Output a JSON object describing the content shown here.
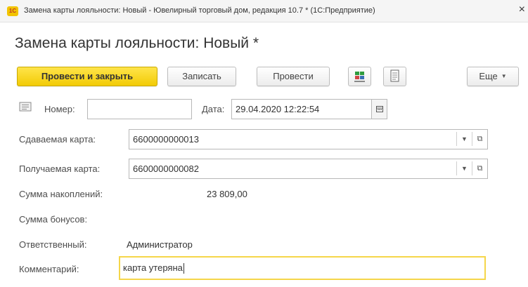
{
  "window": {
    "title": "Замена карты лояльности: Новый - Ювелирный торговый дом, редакция 10.7 * (1С:Предприятие)",
    "close_glyph": "×",
    "app_icon_text": "1С"
  },
  "form": {
    "title": "Замена карты лояльности: Новый *"
  },
  "toolbar": {
    "post_close_label": "Провести и закрыть",
    "save_label": "Записать",
    "post_label": "Провести",
    "more_label": "Еще",
    "more_caret": "▼",
    "icons": [
      "debit-credit-icon",
      "report-icon"
    ]
  },
  "header": {
    "number_label": "Номер:",
    "number_value": "",
    "date_label": "Дата:",
    "date_value": "29.04.2020 12:22:54"
  },
  "fields": {
    "given_card_label": "Сдаваемая карта:",
    "given_card_value": "6600000000013",
    "received_card_label": "Получаемая карта:",
    "received_card_value": "6600000000082",
    "accumulation_label": "Сумма накоплений:",
    "accumulation_value": "23 809,00",
    "bonus_label": "Сумма бонусов:",
    "responsible_label": "Ответственный:",
    "responsible_value": "Администратор",
    "comment_label": "Комментарий:",
    "comment_value": "карта утеряна"
  },
  "colors": {
    "primary_button": "#f2cb05",
    "focus_border": "#f5d64a"
  }
}
